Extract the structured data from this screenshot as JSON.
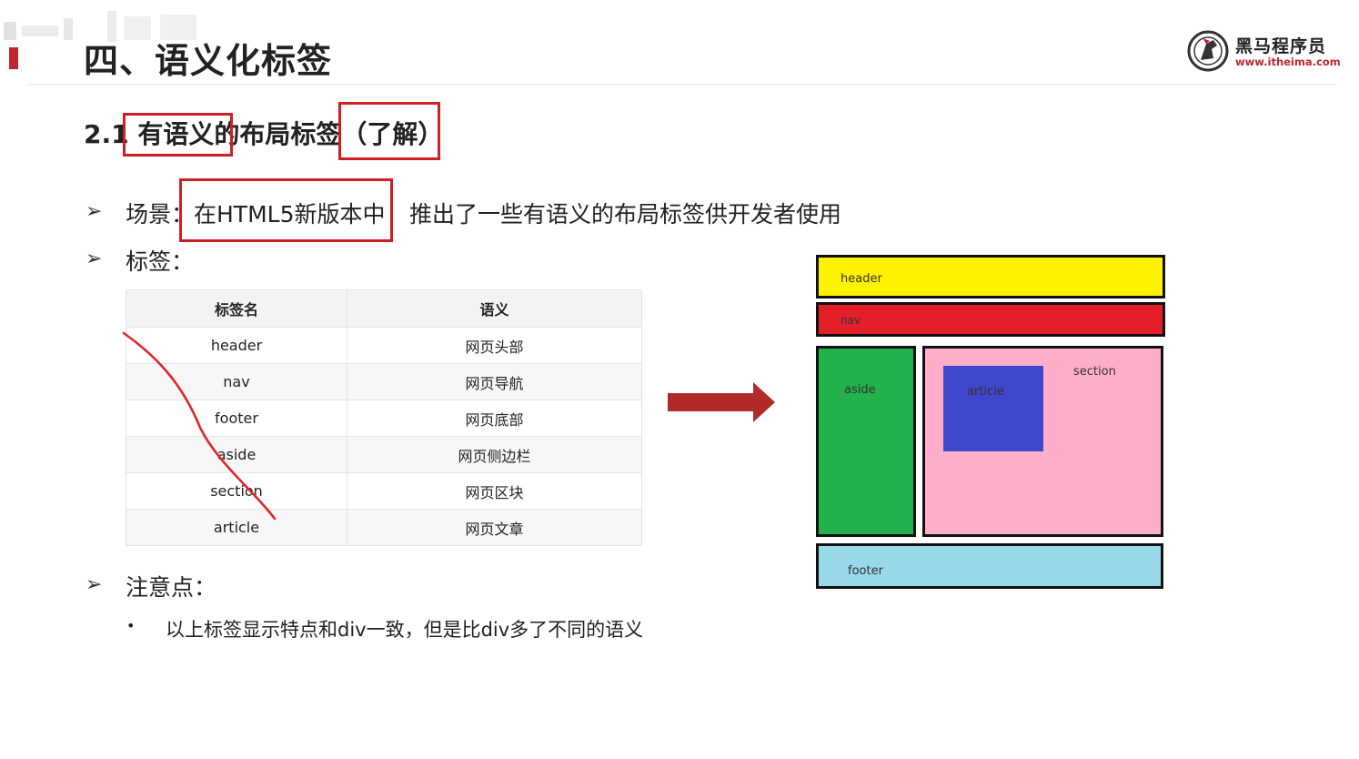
{
  "slide": {
    "title": "四、语义化标签",
    "subtitle_prefix": "2.1 ",
    "subtitle_boxed": "有语义的",
    "subtitle_middle": "布局标签",
    "subtitle_paren": "（了解）"
  },
  "logo": {
    "name": "黑马程序员",
    "url": "www.itheima.com"
  },
  "scene": {
    "label": "场景：",
    "boxed": "在HTML5新版本中",
    "rest": "推出了一些有语义的布局标签供开发者使用"
  },
  "tags_label": "标签：",
  "table": {
    "headers": [
      "标签名",
      "语义"
    ],
    "rows": [
      [
        "header",
        "网页头部"
      ],
      [
        "nav",
        "网页导航"
      ],
      [
        "footer",
        "网页底部"
      ],
      [
        "aside",
        "网页侧边栏"
      ],
      [
        "section",
        "网页区块"
      ],
      [
        "article",
        "网页文章"
      ]
    ]
  },
  "notes": {
    "label": "注意点：",
    "items": [
      "以上标签显示特点和div一致，但是比div多了不同的语义"
    ]
  },
  "diagram": {
    "header": "header",
    "nav": "nav",
    "aside": "aside",
    "section": "section",
    "article": "article",
    "footer": "footer",
    "colors": {
      "header": "#fff200",
      "nav": "#e3202a",
      "aside": "#22b14c",
      "section": "#ffaec9",
      "article": "#3f48cc",
      "footer": "#99d9ea",
      "arrow": "#b02a2a"
    }
  }
}
